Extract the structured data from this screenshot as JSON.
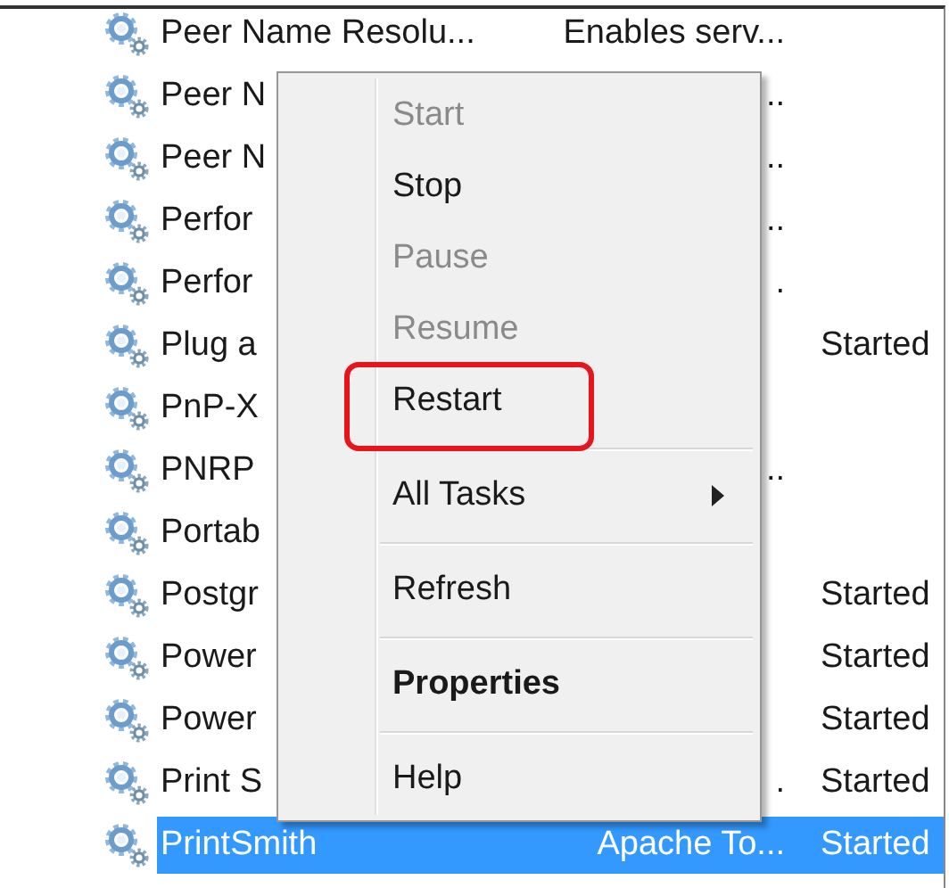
{
  "services": {
    "rows": [
      {
        "name": "Peer Name Resolu...",
        "description": "Enables serv...",
        "selected": false
      },
      {
        "name": "Peer N",
        "description": "..",
        "selected": false
      },
      {
        "name": "Peer N",
        "description": "..",
        "selected": false
      },
      {
        "name": "Perfor",
        "description": "..",
        "selected": false
      },
      {
        "name": "Perfor",
        "description": ".",
        "selected": false
      },
      {
        "name": "Plug a",
        "status": "Started",
        "selected": false
      },
      {
        "name": "PnP-X",
        "selected": false
      },
      {
        "name": "PNRP",
        "description": "..",
        "selected": false
      },
      {
        "name": "Portab",
        "selected": false
      },
      {
        "name": "Postgr",
        "status": "Started",
        "selected": false
      },
      {
        "name": "Power",
        "status": "Started",
        "selected": false
      },
      {
        "name": "Power",
        "status": "Started",
        "selected": false
      },
      {
        "name": "Print S",
        "description": ".",
        "status": "Started",
        "selected": false
      },
      {
        "name": "PrintSmith",
        "description": "Apache To...",
        "status": "Started",
        "selected": true
      }
    ]
  },
  "context_menu": {
    "items": [
      {
        "kind": "item",
        "label": "Start",
        "disabled": true
      },
      {
        "kind": "item",
        "label": "Stop",
        "disabled": false
      },
      {
        "kind": "item",
        "label": "Pause",
        "disabled": true
      },
      {
        "kind": "item",
        "label": "Resume",
        "disabled": true
      },
      {
        "kind": "item",
        "label": "Restart",
        "disabled": false,
        "highlighted": true
      },
      {
        "kind": "separator"
      },
      {
        "kind": "item",
        "label": "All Tasks",
        "disabled": false,
        "submenu": true
      },
      {
        "kind": "separator"
      },
      {
        "kind": "item",
        "label": "Refresh",
        "disabled": false
      },
      {
        "kind": "separator"
      },
      {
        "kind": "item",
        "label": "Properties",
        "disabled": false,
        "default": true
      },
      {
        "kind": "separator"
      },
      {
        "kind": "item",
        "label": "Help",
        "disabled": false
      }
    ]
  }
}
